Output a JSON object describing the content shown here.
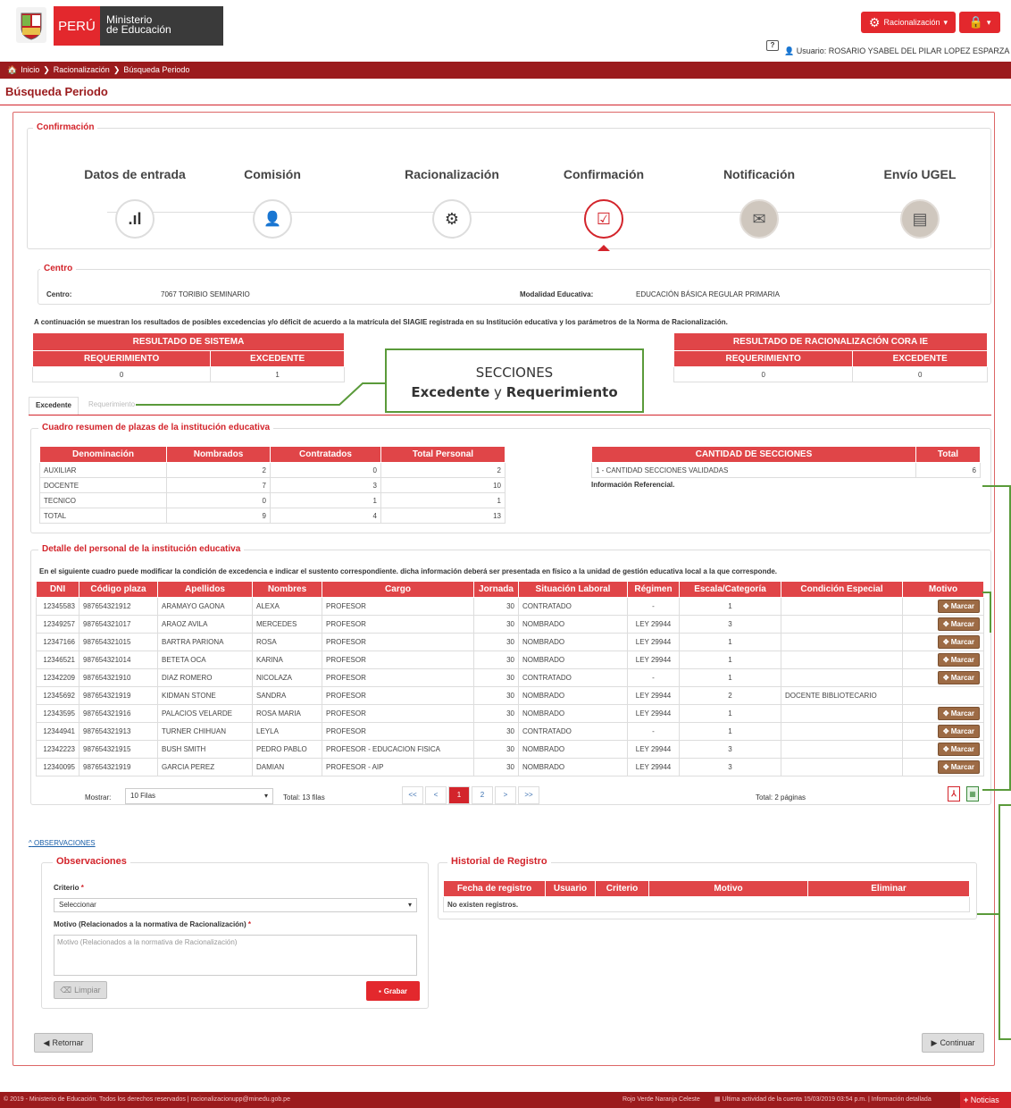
{
  "header": {
    "country": "PERÚ",
    "ministry_line1": "Ministerio",
    "ministry_line2": "de Educación",
    "menu_label": "Racionalización",
    "help": "?",
    "user": "Usuario: ROSARIO YSABEL DEL PILAR LOPEZ ESPARZA"
  },
  "breadcrumb": [
    "Inicio",
    "Racionalización",
    "Búsqueda Periodo"
  ],
  "page_title": "Búsqueda Periodo",
  "section_title": "Confirmación",
  "steps": [
    {
      "label": "Datos de entrada",
      "icon": "bar-chart-icon",
      "glyph": ".ıl"
    },
    {
      "label": "Comisión",
      "icon": "user-icon",
      "glyph": "👤"
    },
    {
      "label": "Racionalización",
      "icon": "gear-icon",
      "glyph": "⚙"
    },
    {
      "label": "Confirmación",
      "icon": "check-square-icon",
      "glyph": "☑"
    },
    {
      "label": "Notificación",
      "icon": "envelope-icon",
      "glyph": "✉"
    },
    {
      "label": "Envío UGEL",
      "icon": "list-icon",
      "glyph": "▤"
    }
  ],
  "centro": {
    "legend": "Centro",
    "centro_label": "Centro:",
    "centro_value": "7067 TORIBIO SEMINARIO",
    "modalidad_label": "Modalidad Educativa:",
    "modalidad_value": "EDUCACIÓN BÁSICA REGULAR PRIMARIA"
  },
  "intro_text": "A continuación se muestran los resultados de posibles excedencias y/o déficit de acuerdo a la matrícula del SIAGIE registrada en su Institución educativa y los parámetros de la Norma de Racionalización.",
  "resultado_sistema": {
    "title": "RESULTADO DE SISTEMA",
    "req_label": "REQUERIMIENTO",
    "exc_label": "EXCEDENTE",
    "req": "0",
    "exc": "1"
  },
  "resultado_cora": {
    "title": "RESULTADO DE RACIONALIZACIÓN CORA IE",
    "req_label": "REQUERIMIENTO",
    "exc_label": "EXCEDENTE",
    "req": "0",
    "exc": "0"
  },
  "callout": {
    "line1": "SECCIONES",
    "bold1": "Excedente",
    "mid": " y ",
    "bold2": "Requerimiento"
  },
  "tabs": [
    "Excedente",
    "Requerimiento"
  ],
  "resumen": {
    "legend": "Cuadro resumen de plazas de la institución educativa",
    "headers": [
      "Denominación",
      "Nombrados",
      "Contratados",
      "Total Personal"
    ],
    "rows": [
      [
        "AUXILIAR",
        "2",
        "0",
        "2"
      ],
      [
        "DOCENTE",
        "7",
        "3",
        "10"
      ],
      [
        "TECNICO",
        "0",
        "1",
        "1"
      ],
      [
        "TOTAL",
        "9",
        "4",
        "13"
      ]
    ]
  },
  "secciones": {
    "headers": [
      "CANTIDAD DE SECCIONES",
      "Total"
    ],
    "rows": [
      [
        "1 - CANTIDAD SECCIONES VALIDADAS",
        "6"
      ]
    ],
    "note": "Información Referencial."
  },
  "detalle": {
    "legend": "Detalle del personal de la institución educativa",
    "note": "En el siguiente cuadro puede modificar la condición de excedencia e indicar el sustento correspondiente. dicha información deberá ser presentada en físico a la unidad de gestión educativa local a la que corresponde.",
    "headers": [
      "DNI",
      "Código plaza",
      "Apellidos",
      "Nombres",
      "Cargo",
      "Jornada",
      "Situación Laboral",
      "Régimen",
      "Escala/Categoría",
      "Condición Especial",
      "Motivo"
    ],
    "marcar_label": "Marcar",
    "rows": [
      [
        "12345583",
        "987654321912",
        "ARAMAYO GAONA",
        "ALEXA",
        "PROFESOR",
        "30",
        "CONTRATADO",
        "-",
        "1",
        "",
        true
      ],
      [
        "12349257",
        "987654321017",
        "ARAOZ AVILA",
        "MERCEDES",
        "PROFESOR",
        "30",
        "NOMBRADO",
        "LEY 29944",
        "3",
        "",
        true
      ],
      [
        "12347166",
        "987654321015",
        "BARTRA PARIONA",
        "ROSA",
        "PROFESOR",
        "30",
        "NOMBRADO",
        "LEY 29944",
        "1",
        "",
        true
      ],
      [
        "12346521",
        "987654321014",
        "BETETA OCA",
        "KARINA",
        "PROFESOR",
        "30",
        "NOMBRADO",
        "LEY 29944",
        "1",
        "",
        true
      ],
      [
        "12342209",
        "987654321910",
        "DIAZ ROMERO",
        "NICOLAZA",
        "PROFESOR",
        "30",
        "CONTRATADO",
        "-",
        "1",
        "",
        true
      ],
      [
        "12345692",
        "987654321919",
        "KIDMAN STONE",
        "SANDRA",
        "PROFESOR",
        "30",
        "NOMBRADO",
        "LEY 29944",
        "2",
        "DOCENTE BIBLIOTECARIO",
        false
      ],
      [
        "12343595",
        "987654321916",
        "PALACIOS VELARDE",
        "ROSA MARIA",
        "PROFESOR",
        "30",
        "NOMBRADO",
        "LEY 29944",
        "1",
        "",
        true
      ],
      [
        "12344941",
        "987654321913",
        "TURNER CHIHUAN",
        "LEYLA",
        "PROFESOR",
        "30",
        "CONTRATADO",
        "-",
        "1",
        "",
        true
      ],
      [
        "12342223",
        "987654321915",
        "BUSH SMITH",
        "PEDRO PABLO",
        "PROFESOR - EDUCACION FISICA",
        "30",
        "NOMBRADO",
        "LEY 29944",
        "3",
        "",
        true
      ],
      [
        "12340095",
        "987654321919",
        "GARCIA PEREZ",
        "DAMIAN",
        "PROFESOR - AIP",
        "30",
        "NOMBRADO",
        "LEY 29944",
        "3",
        "",
        true
      ]
    ]
  },
  "pager": {
    "mostrar_label": "Mostrar:",
    "filas": "10 Filas",
    "total_filas": "Total: 13 filas",
    "pages": [
      "<<",
      "<",
      "1",
      "2",
      ">",
      ">>"
    ],
    "current": "1",
    "total_paginas": "Total: 2 páginas"
  },
  "observaciones": {
    "toggle": "OBSERVACIONES",
    "legend": "Observaciones",
    "criterio_label": "Criterio",
    "criterio_value": "Seleccionar",
    "motivo_label": "Motivo (Relacionados a la normativa de Racionalización)",
    "motivo_placeholder": "Motivo (Relacionados a la normativa de Racionalización)",
    "limpiar": "Limpiar",
    "grabar": "Grabar",
    "required": "*"
  },
  "historial": {
    "legend": "Historial de Registro",
    "headers": [
      "Fecha de registro",
      "Usuario",
      "Criterio",
      "Motivo",
      "Eliminar"
    ],
    "empty": "No existen registros."
  },
  "nav": {
    "retornar": "Retornar",
    "continuar": "Continuar"
  },
  "footer": {
    "left": "© 2019 - Ministerio de Educación. Todos los derechos reservados  |  racionalizacionupp@minedu.gob.pe",
    "themes": "Rojo Verde Naranja Celeste",
    "activity": "Ultima actividad de la cuenta 15/03/2019 03:54 p.m.  |  Información detallada",
    "noticias": "Noticias"
  },
  "colors": {
    "primary": "#e3282d",
    "dark": "#9b1b1d",
    "marcar": "#9d6b45",
    "annotation": "#5a9a3a"
  }
}
